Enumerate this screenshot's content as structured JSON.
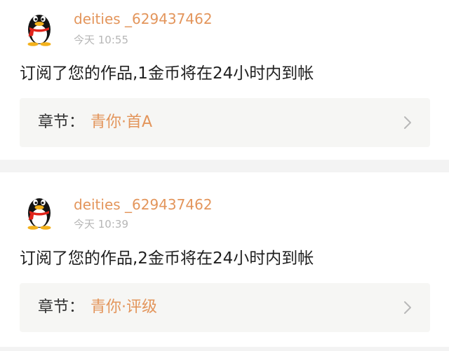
{
  "notifications": [
    {
      "username": "deities _629437462",
      "time": "今天 10:55",
      "message": "订阅了您的作品,1金币将在24小时内到帐",
      "chapter_label": "章节：",
      "chapter_title": "青你·首A",
      "avatar_icon": "qq-penguin-icon",
      "chevron_icon": "chevron-right-icon"
    },
    {
      "username": "deities _629437462",
      "time": "今天 10:39",
      "message": "订阅了您的作品,2金币将在24小时内到帐",
      "chapter_label": "章节：",
      "chapter_title": "青你·评级",
      "avatar_icon": "qq-penguin-icon",
      "chevron_icon": "chevron-right-icon"
    }
  ],
  "colors": {
    "username": "#e3955b",
    "chapter_title": "#e3955b",
    "time": "#b6b6b6",
    "page_background": "#f3f3f3",
    "card_background": "#ffffff",
    "chapter_box_background": "#f6f6f4"
  }
}
